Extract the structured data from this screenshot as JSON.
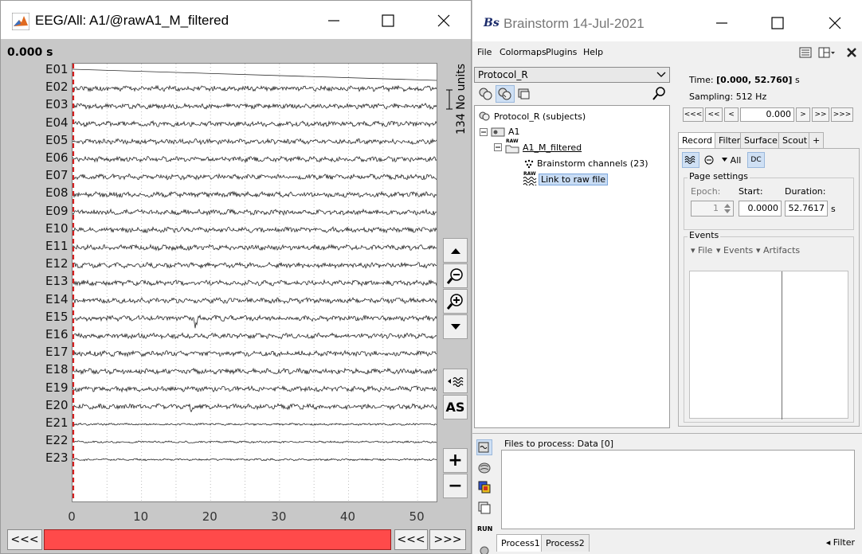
{
  "eeg_window": {
    "title": "EEG/All: A1/@rawA1_M_filtered",
    "time_readout": "0.000 s",
    "scale_label": "134 No units",
    "channels": [
      "E01",
      "E02",
      "E03",
      "E04",
      "E05",
      "E06",
      "E07",
      "E08",
      "E09",
      "E10",
      "E11",
      "E12",
      "E13",
      "E14",
      "E15",
      "E16",
      "E17",
      "E18",
      "E19",
      "E20",
      "E21",
      "E22",
      "E23"
    ],
    "x_ticks": [
      "0",
      "10",
      "20",
      "30",
      "40",
      "50"
    ],
    "x_range": [
      0,
      52.76
    ],
    "side_buttons": {
      "as_label": "AS",
      "plus_label": "+",
      "minus_label": "−"
    },
    "bottom_nav": {
      "left": "<<<",
      "right_prev": "<<<",
      "right_next": ">>>"
    },
    "colors": {
      "slider": "#ff4a4a",
      "cursor": "#d62020",
      "trace": "#2a2a2a"
    }
  },
  "brainstorm": {
    "logo": "Bs",
    "title": "Brainstorm 14-Jul-2021",
    "menu": [
      "File",
      "Colormaps",
      "Plugins",
      "Help"
    ],
    "protocol": "Protocol_R",
    "tree": {
      "root": "Protocol_R (subjects)",
      "subject": "A1",
      "raw_badge": "RAW",
      "condition": "A1_M_filtered",
      "channels": "Brainstorm channels (23)",
      "link": "Link to raw file"
    },
    "time_panel": {
      "time_label": "Time:",
      "time_value": "[0.000, 52.760]",
      "time_unit": "s",
      "sampling": "Sampling: 512 Hz",
      "nav": [
        "<<<",
        "<<",
        "<",
        ">",
        ">>",
        ">>>"
      ],
      "current": "0.000"
    },
    "tabs": [
      "Record",
      "Filter",
      "Surface",
      "Scout",
      "+"
    ],
    "record": {
      "all_label": "All",
      "dc_label": "DC",
      "page_settings": "Page settings",
      "epoch_label": "Epoch:",
      "start_label": "Start:",
      "duration_label": "Duration:",
      "epoch_value": "1",
      "start_value": "0.0000",
      "duration_value": "52.7617",
      "duration_unit": "s",
      "events_title": "Events",
      "events_menus": [
        "File",
        "Events",
        "Artifacts"
      ]
    },
    "process": {
      "files_title": "Files to process: Data [0]",
      "run_label": "RUN",
      "tabs": [
        "Process1",
        "Process2"
      ],
      "filter_label": "Filter"
    }
  }
}
